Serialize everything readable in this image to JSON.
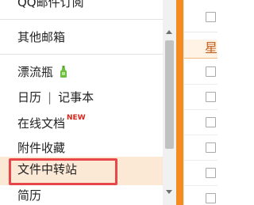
{
  "nav": {
    "subscribe": "QQ邮件订阅",
    "other_mailbox": "其他邮箱",
    "drift_bottle": "漂流瓶",
    "calendar": "日历",
    "calendar_sep": "|",
    "notebook": "记事本",
    "online_doc": "在线文档",
    "online_doc_badge": "NEW",
    "attachment_favorites": "附件收藏",
    "file_transfer": "文件中转站",
    "resume": "简历"
  },
  "right_panel": {
    "group_header": "星"
  },
  "colors": {
    "accent_orange": "#f58a1f",
    "selected_bg": "#fbe9d6",
    "highlight_border": "#e8474a",
    "new_badge": "#d9261c"
  },
  "icons": {
    "bottle": "green-bottle-icon",
    "scroll_up": "triangle-up",
    "scroll_down": "triangle-down"
  }
}
